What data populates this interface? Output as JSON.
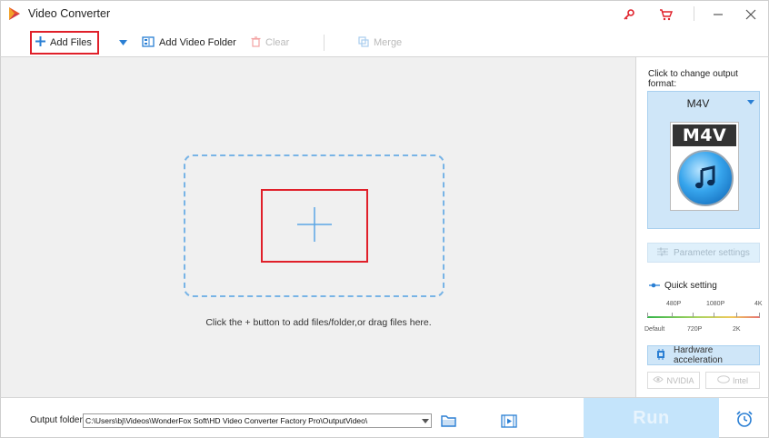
{
  "app": {
    "title": "Video Converter"
  },
  "toolbar": {
    "add_files": "Add Files",
    "add_video_folder": "Add Video Folder",
    "clear": "Clear",
    "merge": "Merge"
  },
  "main": {
    "drop_hint": "Click the + button to add files/folder,or drag files here."
  },
  "right_panel": {
    "change_format_label": "Click to change output format:",
    "format_name": "M4V",
    "format_thumb_text": "M4V",
    "parameter_settings": "Parameter settings",
    "quick_setting": "Quick setting",
    "quality_top": [
      "480P",
      "1080P",
      "4K"
    ],
    "quality_bottom": [
      "Default",
      "720P",
      "2K"
    ],
    "hardware_acceleration": "Hardware acceleration",
    "nvidia": "NVIDIA",
    "intel": "Intel"
  },
  "bottom": {
    "output_folder_label": "Output folder:",
    "output_path": "C:\\Users\\bj\\Videos\\WonderFox Soft\\HD Video Converter Factory Pro\\OutputVideo\\",
    "run": "Run"
  },
  "colors": {
    "accent_blue": "#2a7fd4",
    "highlight_red": "#e0202a",
    "run_disabled": "#c4e4fb"
  },
  "icons": [
    "app-logo-icon",
    "key-icon",
    "cart-icon",
    "minimize-icon",
    "close-icon",
    "plus-icon",
    "film-folder-icon",
    "trash-icon",
    "merge-icon",
    "sliders-icon",
    "chip-icon",
    "folder-icon",
    "video-folder-icon",
    "alarm-clock-icon"
  ]
}
